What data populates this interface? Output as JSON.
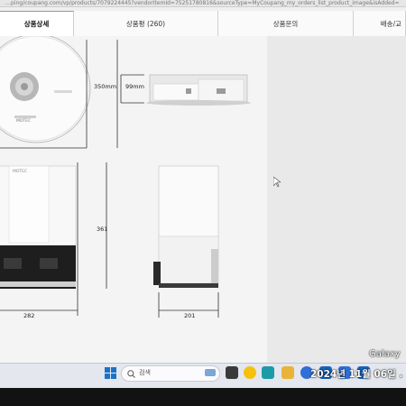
{
  "browser": {
    "url": "…ping/coupang.com/vp/products/7079224445?vendorItemId=75251780816&sourceType=MyCoupang_my_orders_list_product_image&isAdded="
  },
  "tabs": [
    {
      "label": "상품상세"
    },
    {
      "label": "상품평 (260)"
    },
    {
      "label": "상품문의"
    },
    {
      "label": "배송/교"
    }
  ],
  "figure": {
    "brand": "MOTEC",
    "dims": {
      "diameter": "350mm",
      "height_robot": "99mm",
      "station_height": "361",
      "station_width_front": "282",
      "station_width_side": "201"
    }
  },
  "taskbar": {
    "search_placeholder": "검색"
  },
  "watermark": {
    "device": "Galaxy",
    "date": "2024년 11월 06일 ."
  },
  "colors": {
    "page_bg": "#f4f4f4",
    "taskbar_bg": "#e4e7ee",
    "edge_blue": "#1a73c8",
    "chrome_yellow": "#f4c20d",
    "files_yellow": "#e9b33a",
    "store_blue": "#2f6fd6",
    "edge_teal": "#1d9aa8",
    "mail_blue": "#1565c0"
  }
}
